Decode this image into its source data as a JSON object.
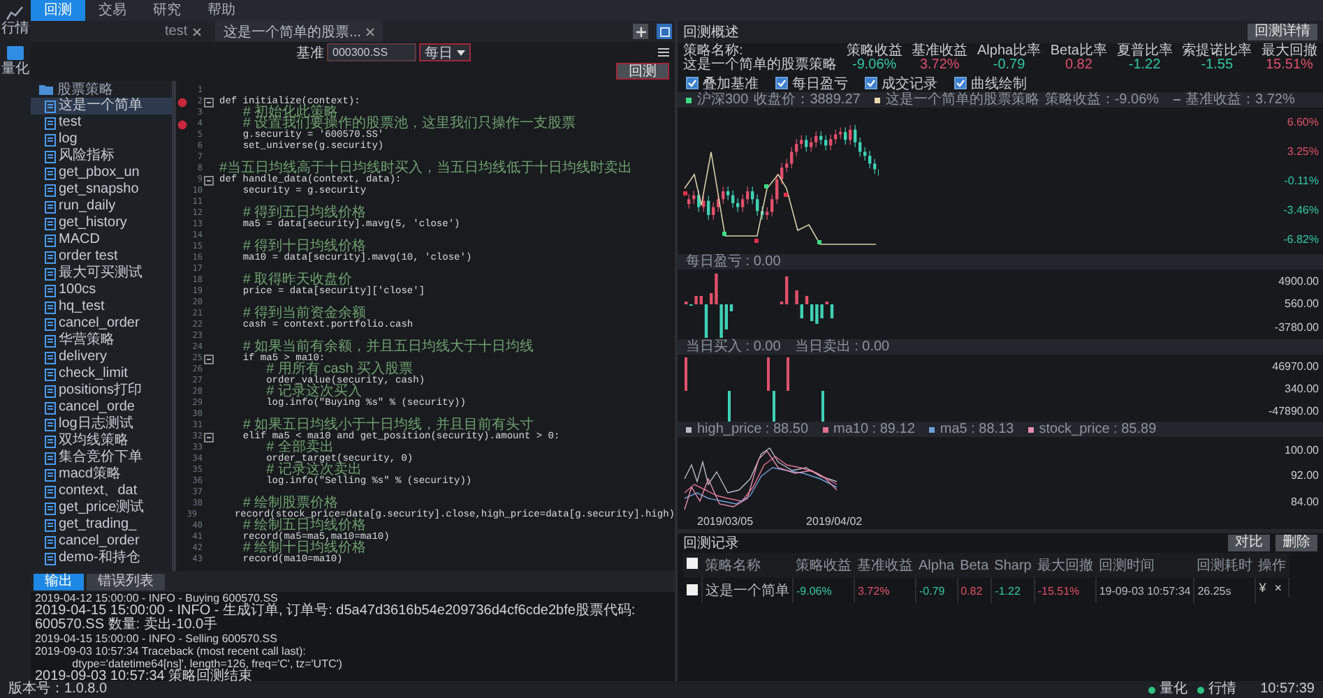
{
  "top_nav": {
    "tabs": [
      {
        "label": "回测",
        "selected": true
      },
      {
        "label": "交易",
        "selected": false
      },
      {
        "label": "研究",
        "selected": false
      },
      {
        "label": "帮助",
        "selected": false
      }
    ]
  },
  "sidebar": {
    "items": [
      {
        "label": "行情",
        "selected": false
      },
      {
        "label": "量化",
        "selected": true
      }
    ]
  },
  "editor_tabs": [
    {
      "label": "test",
      "selected": false
    },
    {
      "label": "这是一个简单的股票...",
      "selected": true
    }
  ],
  "toolbar": {
    "benchmark_label": "基准",
    "benchmark": "000300.SS",
    "frequency": "每日",
    "run_button": "回测"
  },
  "file_tree": {
    "folder": "股票策略",
    "items": [
      {
        "label": "这是一个简单",
        "selected": true
      },
      {
        "label": "test",
        "selected": false
      },
      {
        "label": "log",
        "selected": false
      },
      {
        "label": "风险指标",
        "selected": false
      },
      {
        "label": "get_pbox_un",
        "selected": false
      },
      {
        "label": "get_snapsho",
        "selected": false
      },
      {
        "label": "run_daily",
        "selected": false
      },
      {
        "label": "get_history",
        "selected": false
      },
      {
        "label": "MACD",
        "selected": false
      },
      {
        "label": "order test",
        "selected": false
      },
      {
        "label": "最大可买测试",
        "selected": false
      },
      {
        "label": "100cs",
        "selected": false
      },
      {
        "label": "hq_test",
        "selected": false
      },
      {
        "label": "cancel_order",
        "selected": false
      },
      {
        "label": "华营策略",
        "selected": false
      },
      {
        "label": "delivery",
        "selected": false
      },
      {
        "label": "check_limit",
        "selected": false
      },
      {
        "label": "positions打印",
        "selected": false
      },
      {
        "label": "cancel_orde",
        "selected": false
      },
      {
        "label": "log日志测试",
        "selected": false
      },
      {
        "label": "双均线策略",
        "selected": false
      },
      {
        "label": "集合竞价下单",
        "selected": false
      },
      {
        "label": "macd策略",
        "selected": false
      },
      {
        "label": "context、dat",
        "selected": false
      },
      {
        "label": "get_price测试",
        "selected": false
      },
      {
        "label": "get_trading_",
        "selected": false
      },
      {
        "label": "cancel_order",
        "selected": false
      },
      {
        "label": "demo-和持仓",
        "selected": false
      }
    ]
  },
  "code_lines": [
    {
      "n": "1"
    },
    {
      "n": "2",
      "text": "def initialize(context):",
      "kind": "code",
      "breakpoint": true,
      "fold": true
    },
    {
      "n": "3",
      "text": "    # 初始化此策略",
      "kind": "comment"
    },
    {
      "n": "4",
      "text": "    # 设置我们要操作的股票池，这里我们只操作一支股票",
      "kind": "comment",
      "breakpoint": true
    },
    {
      "n": "5",
      "text": "    g.security = '600570.SS'",
      "kind": "code"
    },
    {
      "n": "6",
      "text": "    set_universe(g.security)",
      "kind": "code"
    },
    {
      "n": "7"
    },
    {
      "n": "8",
      "text": "#当五日均线高于十日均线时买入，当五日均线低于十日均线时卖出",
      "kind": "comment"
    },
    {
      "n": "9",
      "text": "def handle_data(context, data):",
      "kind": "code",
      "fold": true
    },
    {
      "n": "10",
      "text": "    security = g.security",
      "kind": "code"
    },
    {
      "n": "11"
    },
    {
      "n": "12",
      "text": "    # 得到五日均线价格",
      "kind": "comment"
    },
    {
      "n": "13",
      "text": "    ma5 = data[security].mavg(5, 'close')",
      "kind": "code"
    },
    {
      "n": "14"
    },
    {
      "n": "15",
      "text": "    # 得到十日均线价格",
      "kind": "comment"
    },
    {
      "n": "16",
      "text": "    ma10 = data[security].mavg(10, 'close')",
      "kind": "code"
    },
    {
      "n": "17"
    },
    {
      "n": "18",
      "text": "    # 取得昨天收盘价",
      "kind": "comment"
    },
    {
      "n": "19",
      "text": "    price = data[security]['close']",
      "kind": "code"
    },
    {
      "n": "20"
    },
    {
      "n": "21",
      "text": "    # 得到当前资金余额",
      "kind": "comment"
    },
    {
      "n": "22",
      "text": "    cash = context.portfolio.cash",
      "kind": "code"
    },
    {
      "n": "23"
    },
    {
      "n": "24",
      "text": "    # 如果当前有余额，并且五日均线大于十日均线",
      "kind": "comment"
    },
    {
      "n": "25",
      "text": "    if ma5 > ma10:",
      "kind": "code",
      "fold": true
    },
    {
      "n": "26",
      "text": "        # 用所有 cash 买入股票",
      "kind": "comment"
    },
    {
      "n": "27",
      "text": "        order_value(security, cash)",
      "kind": "code"
    },
    {
      "n": "28",
      "text": "        # 记录这次买入",
      "kind": "comment"
    },
    {
      "n": "29",
      "text": "        log.info(\"Buying %s\" % (security))",
      "kind": "code"
    },
    {
      "n": "30"
    },
    {
      "n": "31",
      "text": "    # 如果五日均线小于十日均线，并且目前有头寸",
      "kind": "comment"
    },
    {
      "n": "32",
      "text": "    elif ma5 < ma10 and get_position(security).amount > 0:",
      "kind": "code",
      "fold": true
    },
    {
      "n": "33",
      "text": "        # 全部卖出",
      "kind": "comment"
    },
    {
      "n": "34",
      "text": "        order_target(security, 0)",
      "kind": "code"
    },
    {
      "n": "35",
      "text": "        # 记录这次卖出",
      "kind": "comment"
    },
    {
      "n": "36",
      "text": "        log.info(\"Selling %s\" % (security))",
      "kind": "code"
    },
    {
      "n": "37"
    },
    {
      "n": "38",
      "text": "    # 绘制股票价格",
      "kind": "comment"
    },
    {
      "n": "39",
      "text": "    record(stock_price=data[g.security].close,high_price=data[g.security].high)",
      "kind": "code"
    },
    {
      "n": "40",
      "text": "    # 绘制五日均线价格",
      "kind": "comment"
    },
    {
      "n": "41",
      "text": "    record(ma5=ma5,ma10=ma10)",
      "kind": "code"
    },
    {
      "n": "42",
      "text": "    # 绘制十日均线价格",
      "kind": "comment"
    },
    {
      "n": "43",
      "text": "    record(ma10=ma10)",
      "kind": "code"
    }
  ],
  "output": {
    "tabs": [
      {
        "label": "输出",
        "selected": true
      },
      {
        "label": "错误列表",
        "selected": false
      }
    ],
    "lines": [
      "2019-04-12 15:00:00 - INFO - Buying 600570.SS",
      "2019-04-15 15:00:00 - INFO - 生成订单, 订单号: d5a47d3616b54e209736d4cf6cde2bfe股票代码: 600570.SS 数量: 卖出-10.0手",
      "2019-04-15 15:00:00 - INFO - Selling 600570.SS",
      "2019-09-03 10:57:34 Traceback (most recent call last):",
      "            dtype='datetime64[ns]', length=126, freq='C', tz='UTC')",
      "2019-09-03 10:57:34 策略回测结束"
    ]
  },
  "summary": {
    "title": "回测概述",
    "details_button": "回测详情",
    "strategy_label": "策略名称:",
    "strategy_name": "这是一个简单的股票策略",
    "metrics": [
      {
        "label": "策略收益",
        "value": "-9.06%",
        "kind": "loss"
      },
      {
        "label": "基准收益",
        "value": "3.72%",
        "kind": "gain"
      },
      {
        "label": "Alpha比率",
        "value": "-0.79",
        "kind": "loss"
      },
      {
        "label": "Beta比率",
        "value": "0.82",
        "kind": "gain"
      },
      {
        "label": "夏普比率",
        "value": "-1.22",
        "kind": "loss"
      },
      {
        "label": "索提诺比率",
        "value": "-1.55",
        "kind": "loss"
      },
      {
        "label": "最大回撤",
        "value": "15.51%",
        "kind": "gain"
      }
    ]
  },
  "options": [
    {
      "label": "叠加基准",
      "checked": true
    },
    {
      "label": "每日盈亏",
      "checked": true
    },
    {
      "label": "成交记录",
      "checked": true
    },
    {
      "label": "曲线绘制",
      "checked": true
    }
  ],
  "price_chart": {
    "legend": [
      {
        "kind": "dot",
        "color": "#3ddc84",
        "name": "沪深300",
        "value": "收盘价：3889.27"
      },
      {
        "kind": "dot",
        "color": "#e8d8b0",
        "name": "这是一个简单的股票策略",
        "value": "策略收益：-9.06%"
      },
      {
        "kind": "dash",
        "color": "#8a8f99",
        "value": "基准收益：3.72%"
      }
    ],
    "y_labels": [
      {
        "text": "6.60%",
        "kind": "gain"
      },
      {
        "text": "3.25%",
        "kind": "gain"
      },
      {
        "text": "-0.11%",
        "kind": "loss"
      },
      {
        "text": "-3.46%",
        "kind": "loss"
      },
      {
        "text": "-6.82%",
        "kind": "loss"
      }
    ]
  },
  "pnl_chart": {
    "legend": [
      "每日盈亏 : 0.00"
    ],
    "y_labels": [
      "4900.00",
      "560.00",
      "-3780.00"
    ]
  },
  "trade_chart": {
    "legend": [
      "当日买入 : 0.00",
      "当日卖出 : 0.00"
    ],
    "y_labels": [
      "46970.00",
      "340.00",
      "-47890.00"
    ]
  },
  "record_chart": {
    "legend": [
      {
        "label": "high_price : 88.50",
        "color": "#b8bcc6"
      },
      {
        "label": "ma10 : 89.12",
        "color": "#e0708e"
      },
      {
        "label": "ma5 : 88.13",
        "color": "#6f9fd8"
      },
      {
        "label": "stock_price : 85.89",
        "color": "#e58fb0"
      }
    ],
    "y_labels": [
      "100.00",
      "92.00",
      "84.00"
    ],
    "x_labels": [
      "2019/03/05",
      "2019/04/02"
    ]
  },
  "records": {
    "title": "回测记录",
    "buttons": [
      "对比",
      "删除"
    ],
    "all_selected": false,
    "columns": [
      "策略名称",
      "策略收益",
      "基准收益",
      "Alpha",
      "Beta",
      "Sharp",
      "最大回撤",
      "回测时间",
      "回测耗时",
      "操作"
    ],
    "rows": [
      {
        "selected": false,
        "cells": [
          {
            "text": "这是一个简单",
            "kind": "plain"
          },
          {
            "text": "-9.06%",
            "kind": "loss"
          },
          {
            "text": "3.72%",
            "kind": "gain"
          },
          {
            "text": "-0.79",
            "kind": "loss"
          },
          {
            "text": "0.82",
            "kind": "gain"
          },
          {
            "text": "-1.22",
            "kind": "loss"
          },
          {
            "text": "-15.51%",
            "kind": "gain"
          },
          {
            "text": "19-09-03 10:57:34",
            "kind": "plain"
          },
          {
            "text": "26.25s",
            "kind": "plain"
          }
        ],
        "actions": [
          "¥",
          "×"
        ]
      }
    ]
  },
  "status_bar": {
    "version": "版本号：1.0.8.0",
    "indicators": [
      {
        "label": "量化",
        "on": true
      },
      {
        "label": "行情",
        "on": true
      }
    ],
    "time": "10:57:39"
  }
}
